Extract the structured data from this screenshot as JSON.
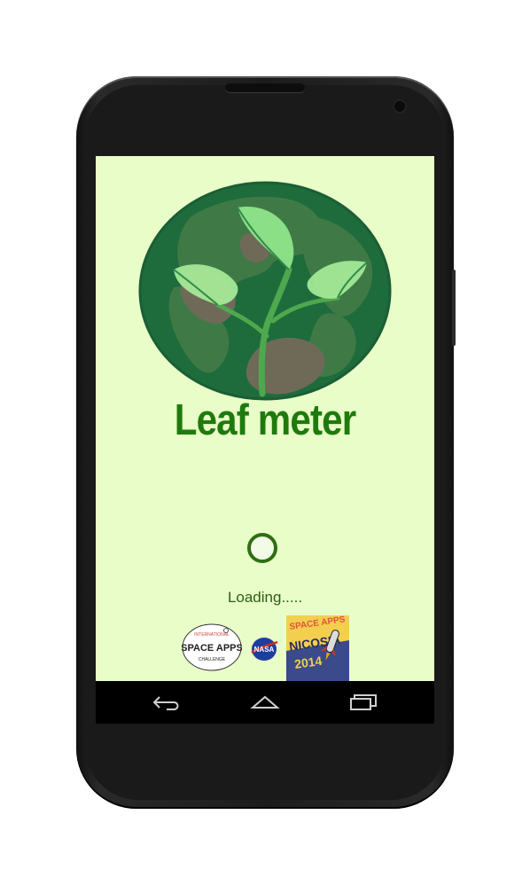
{
  "app": {
    "title": "Leaf meter",
    "loading_text": "Loading.....",
    "colors": {
      "screen_bg": "#e9fdc8",
      "title": "#1f7a0e",
      "logo_dark": "#1e6b3c",
      "logo_land": "#3d7a45",
      "leaf_light": "#8fe58a"
    }
  },
  "badges": {
    "space_apps": {
      "top_text": "INTERNATIONAL",
      "main_text": "SPACE APPS",
      "bottom_text": "CHALLENGE"
    },
    "nasa": {
      "text": "NASA"
    },
    "nicosia": {
      "line1": "SPACE APPS",
      "line2": "NICOSIA",
      "line3": "2014"
    }
  },
  "navbar": {
    "back_icon": "back-icon",
    "home_icon": "home-icon",
    "recents_icon": "recents-icon"
  }
}
